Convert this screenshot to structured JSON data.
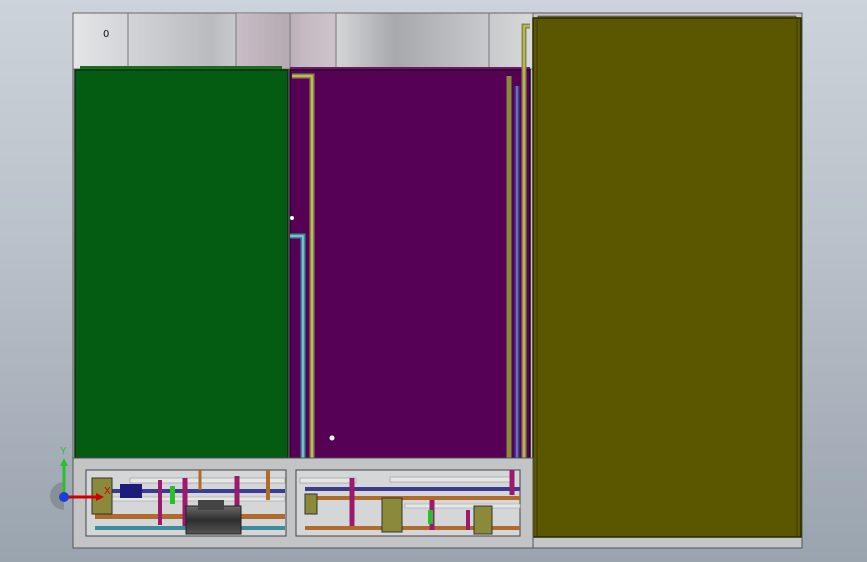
{
  "model": {
    "top_label": "0"
  },
  "colors": {
    "background_top": "#cdd3da",
    "background_bottom": "#9aa4ae",
    "housing": "#c7c9cc",
    "panel_left": "#045b12",
    "panel_middle": "#570156",
    "panel_right": "#5a5700",
    "base": "#c2c4c6",
    "pipe_olive": "#8b8a3a",
    "pipe_teal": "#3c8c9a",
    "pipe_navy": "#3b3b8f",
    "pipe_magenta": "#9a1b6b",
    "pipe_white": "#e6e6e6",
    "pipe_copper": "#b06a2c",
    "pump_dark": "#3a3a3a",
    "axis_x": "#d10000",
    "axis_y": "#2bbf2b",
    "axis_z": "#1b3fd6"
  },
  "triad": {
    "x_label": "X",
    "y_label": "Y"
  }
}
